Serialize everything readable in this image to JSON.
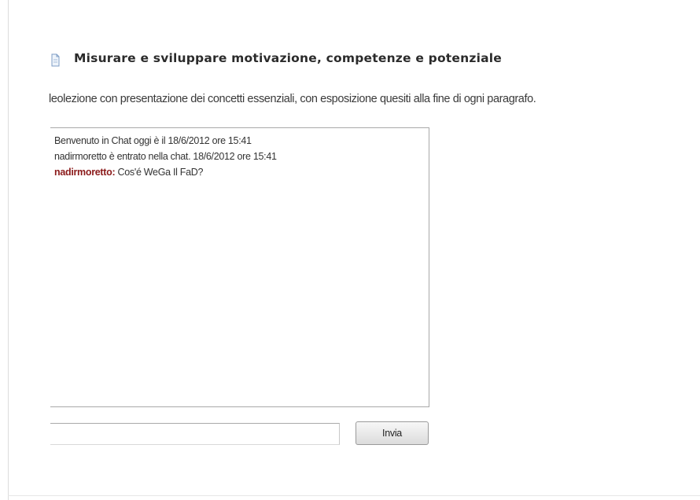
{
  "header": {
    "icon": "document-icon",
    "title": "Misurare e sviluppare motivazione, competenze e potenziale"
  },
  "description": "leolezione con presentazione dei concetti essenziali, con esposizione quesiti alla fine di ogni paragrafo.",
  "chat": {
    "messages": [
      {
        "text": "Benvenuto in Chat oggi è il 18/6/2012 ore 15:41"
      },
      {
        "text": "nadirmoretto è entrato nella chat. 18/6/2012 ore 15:41"
      },
      {
        "user": "nadirmoretto:",
        "text": " Cos'é WeGa Il FaD?"
      }
    ],
    "user_color": "#8b1a1a"
  },
  "composer": {
    "input_value": "",
    "send_label": "Invia"
  }
}
